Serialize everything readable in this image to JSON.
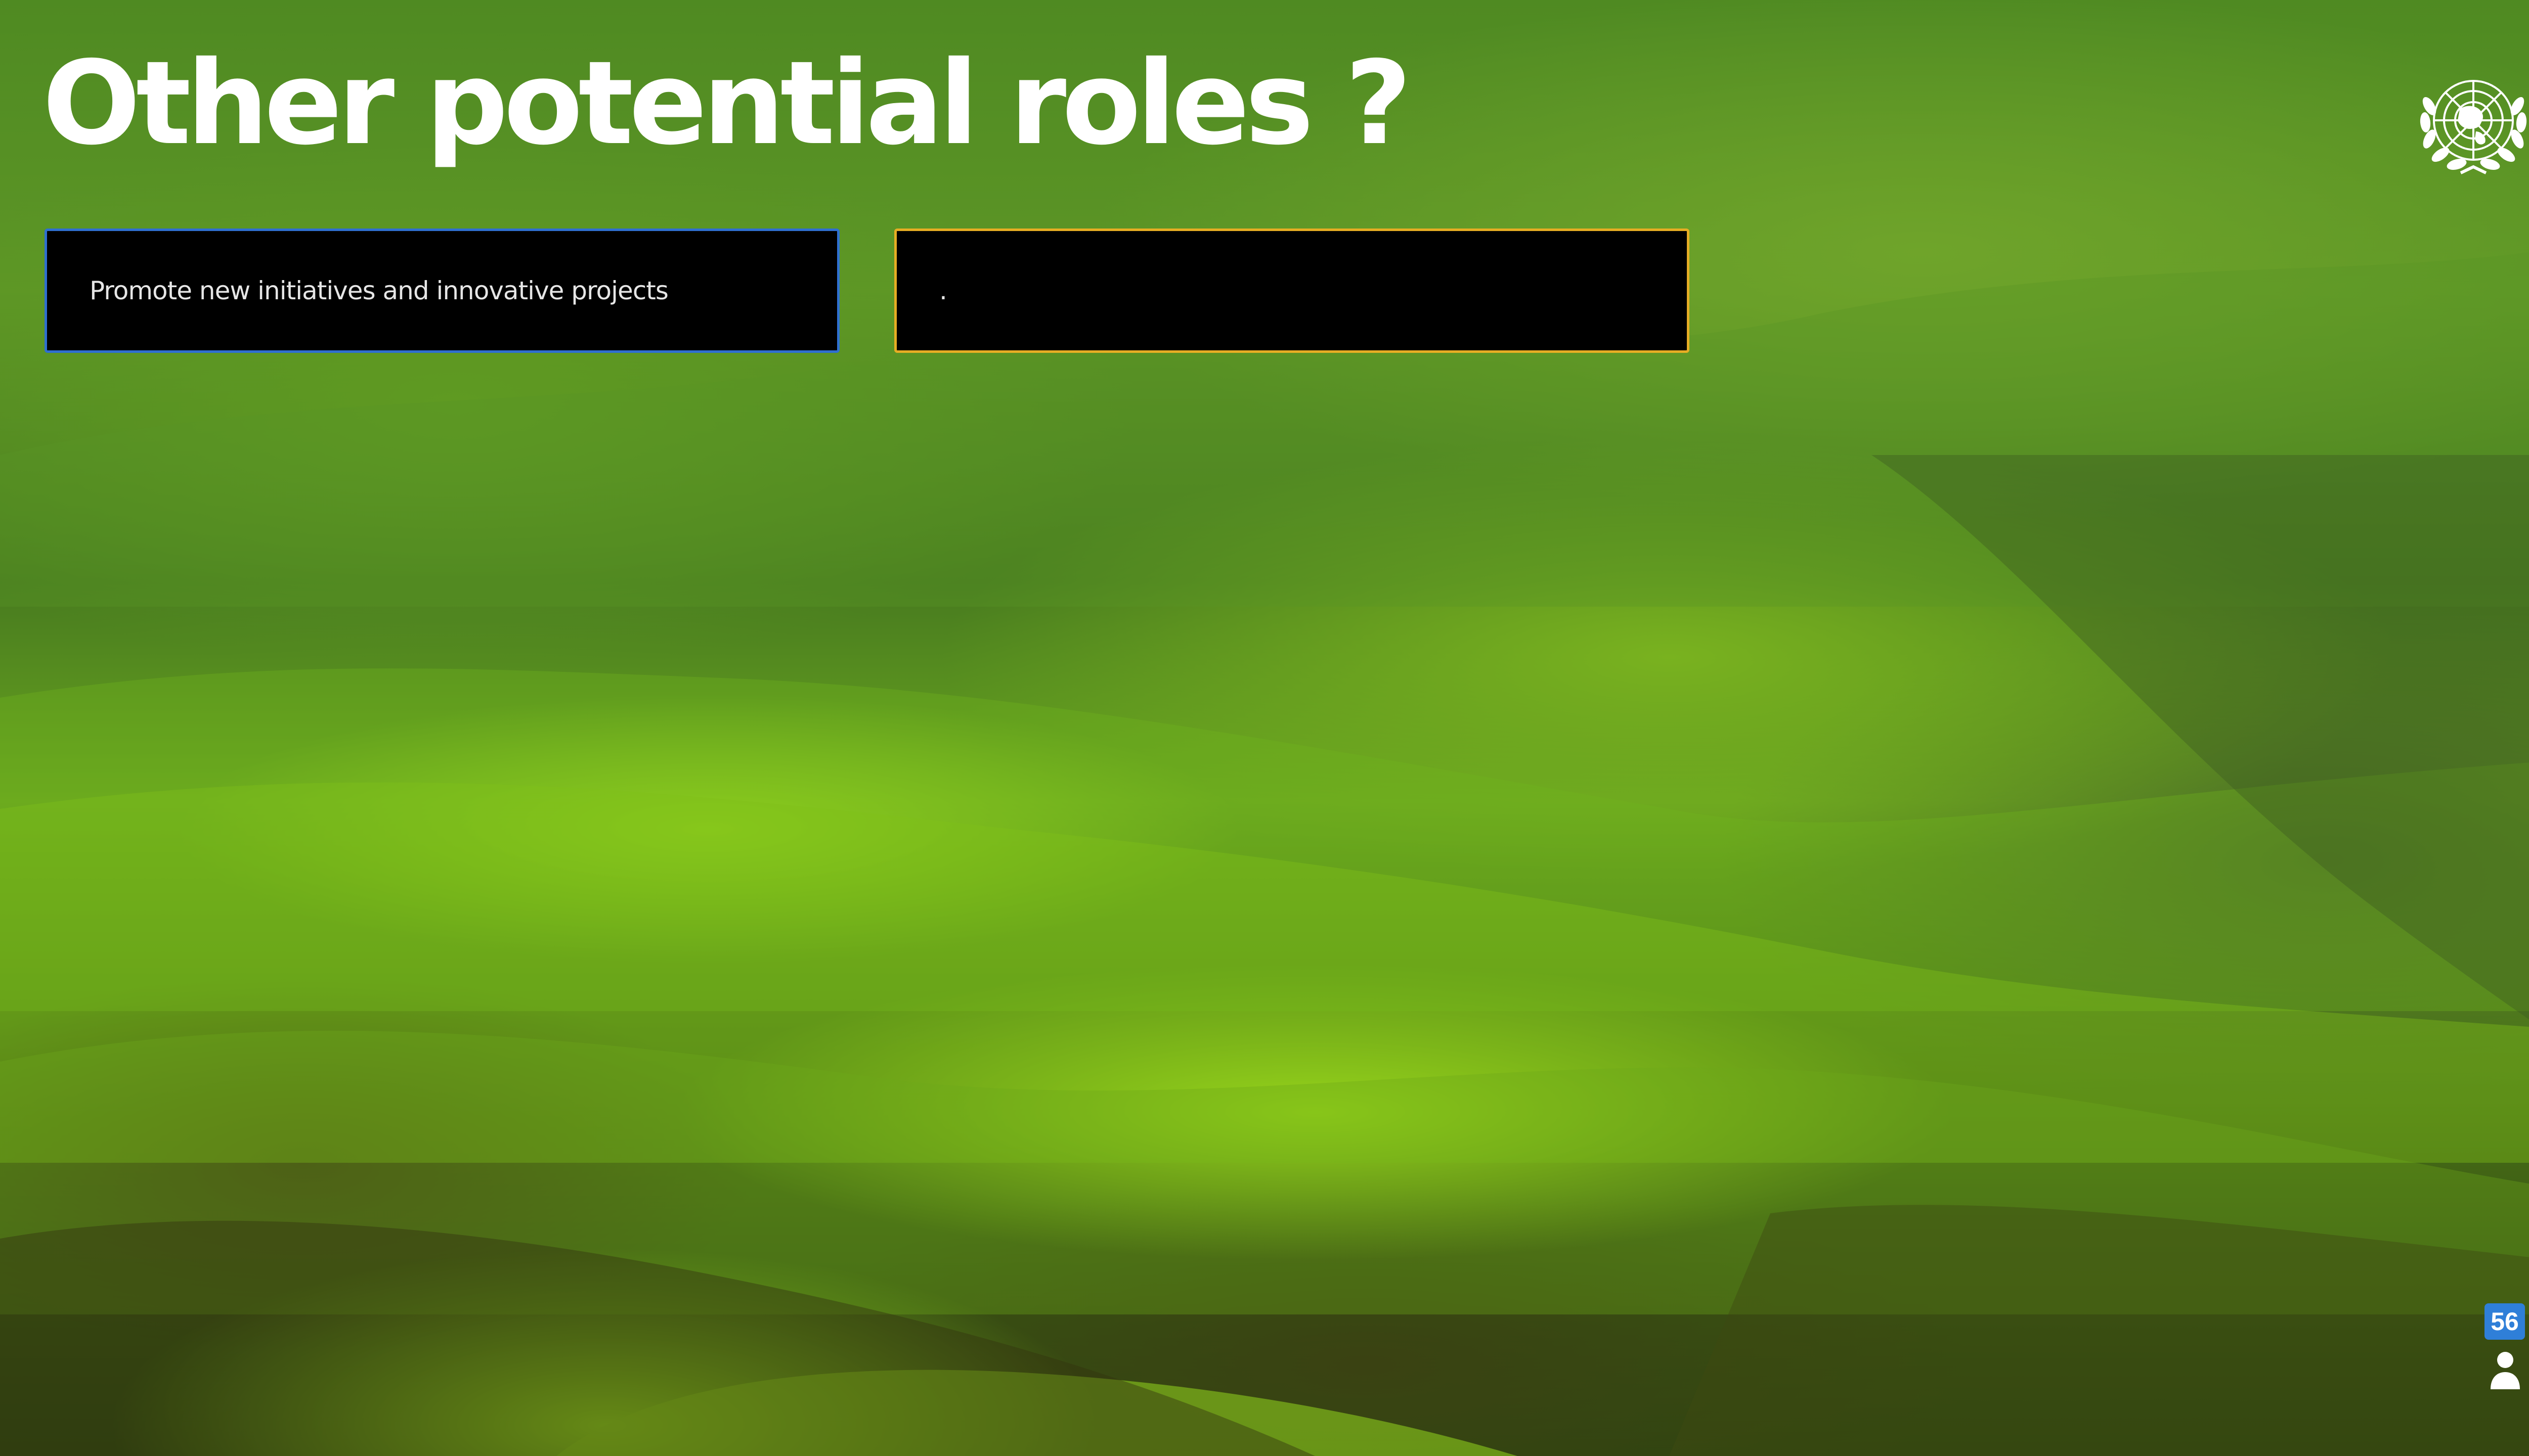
{
  "slide": {
    "title": "Other potential roles ?",
    "cards": [
      {
        "text": "Promote new initiatives and innovative projects",
        "border_color": "#2f6fd0"
      },
      {
        "text": ".",
        "border_color": "#e6ad24"
      }
    ],
    "logo": "united-nations-emblem",
    "page_number": "56",
    "presenter_icon": "person-icon"
  }
}
